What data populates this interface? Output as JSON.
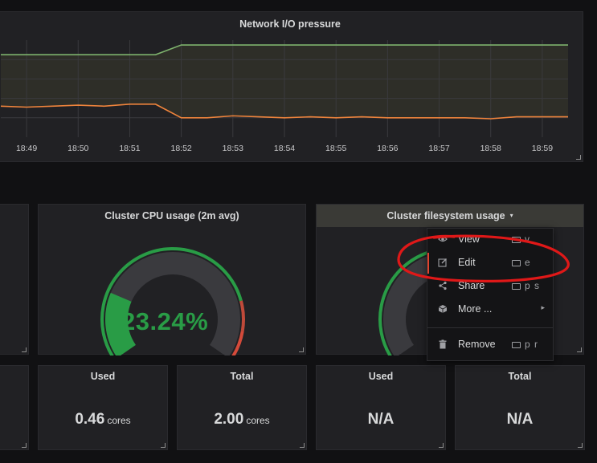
{
  "network_panel": {
    "title": "Network I/O pressure",
    "time_labels": [
      "18:49",
      "18:50",
      "18:51",
      "18:52",
      "18:53",
      "18:54",
      "18:55",
      "18:56",
      "18:57",
      "18:58",
      "18:59"
    ]
  },
  "chart_data": {
    "type": "line",
    "title": "Network I/O pressure",
    "x": [
      "18:48.5",
      "18:49",
      "18:49.5",
      "18:50",
      "18:50.5",
      "18:51",
      "18:51.5",
      "18:52",
      "18:52.5",
      "18:53",
      "18:53.5",
      "18:54",
      "18:54.5",
      "18:55",
      "18:55.5",
      "18:56",
      "18:56.5",
      "18:57",
      "18:57.5",
      "18:58",
      "18:58.5",
      "18:59",
      "18:59.6"
    ],
    "series": [
      {
        "color": "#7eb26d",
        "values": [
          85,
          85,
          85,
          85,
          85,
          85,
          85,
          95,
          95,
          95,
          95,
          95,
          95,
          95,
          95,
          95,
          95,
          95,
          95,
          95,
          95,
          95,
          95
        ]
      },
      {
        "color": "#ef843c",
        "values": [
          32,
          31,
          32,
          33,
          32,
          34,
          34,
          20,
          20,
          22,
          21,
          20,
          21,
          20,
          21,
          20,
          20,
          20,
          20,
          19,
          21,
          21,
          21
        ]
      }
    ],
    "fill": "#3a3a2c",
    "grid": true,
    "legend": "none"
  },
  "cpu_panel": {
    "title": "Cluster CPU usage (2m avg)",
    "value_text": "23.24%",
    "value": 23.24,
    "thresholds": [
      80,
      90
    ],
    "colors": {
      "ok": "#299c46",
      "warn": "#e5ac0e",
      "crit": "#d44a3a"
    }
  },
  "fs_panel": {
    "title": "Cluster filesystem usage",
    "caret": "▾"
  },
  "context_menu": {
    "items": [
      {
        "label": "View",
        "shortcut": "v",
        "icon": "eye-icon"
      },
      {
        "label": "Edit",
        "shortcut": "e",
        "icon": "edit-icon"
      },
      {
        "label": "Share",
        "shortcut": "p s",
        "icon": "share-icon"
      },
      {
        "label": "More ...",
        "shortcut": "",
        "icon": "cube-icon",
        "arrow": "▸"
      },
      {
        "label": "Remove",
        "shortcut": "p r",
        "icon": "trash-icon"
      }
    ]
  },
  "stats": [
    {
      "title": "Used",
      "value": "0.46",
      "unit": "cores"
    },
    {
      "title": "Total",
      "value": "2.00",
      "unit": "cores"
    },
    {
      "title": "Used",
      "value": "N/A",
      "unit": ""
    },
    {
      "title": "Total",
      "value": "N/A",
      "unit": ""
    }
  ],
  "annotation": {
    "color": "#e01818"
  }
}
